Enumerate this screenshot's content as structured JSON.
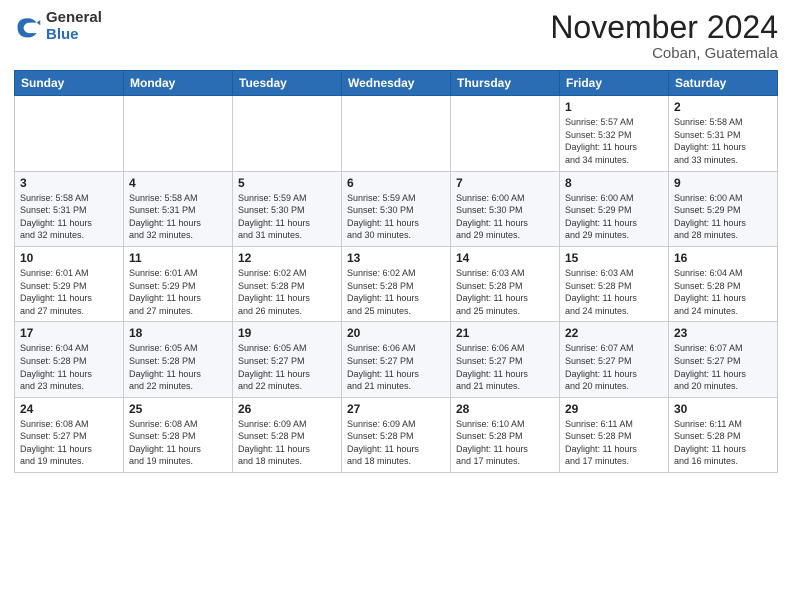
{
  "logo": {
    "general": "General",
    "blue": "Blue"
  },
  "header": {
    "month": "November 2024",
    "location": "Coban, Guatemala"
  },
  "weekdays": [
    "Sunday",
    "Monday",
    "Tuesday",
    "Wednesday",
    "Thursday",
    "Friday",
    "Saturday"
  ],
  "weeks": [
    [
      {
        "day": "",
        "info": ""
      },
      {
        "day": "",
        "info": ""
      },
      {
        "day": "",
        "info": ""
      },
      {
        "day": "",
        "info": ""
      },
      {
        "day": "",
        "info": ""
      },
      {
        "day": "1",
        "info": "Sunrise: 5:57 AM\nSunset: 5:32 PM\nDaylight: 11 hours\nand 34 minutes."
      },
      {
        "day": "2",
        "info": "Sunrise: 5:58 AM\nSunset: 5:31 PM\nDaylight: 11 hours\nand 33 minutes."
      }
    ],
    [
      {
        "day": "3",
        "info": "Sunrise: 5:58 AM\nSunset: 5:31 PM\nDaylight: 11 hours\nand 32 minutes."
      },
      {
        "day": "4",
        "info": "Sunrise: 5:58 AM\nSunset: 5:31 PM\nDaylight: 11 hours\nand 32 minutes."
      },
      {
        "day": "5",
        "info": "Sunrise: 5:59 AM\nSunset: 5:30 PM\nDaylight: 11 hours\nand 31 minutes."
      },
      {
        "day": "6",
        "info": "Sunrise: 5:59 AM\nSunset: 5:30 PM\nDaylight: 11 hours\nand 30 minutes."
      },
      {
        "day": "7",
        "info": "Sunrise: 6:00 AM\nSunset: 5:30 PM\nDaylight: 11 hours\nand 29 minutes."
      },
      {
        "day": "8",
        "info": "Sunrise: 6:00 AM\nSunset: 5:29 PM\nDaylight: 11 hours\nand 29 minutes."
      },
      {
        "day": "9",
        "info": "Sunrise: 6:00 AM\nSunset: 5:29 PM\nDaylight: 11 hours\nand 28 minutes."
      }
    ],
    [
      {
        "day": "10",
        "info": "Sunrise: 6:01 AM\nSunset: 5:29 PM\nDaylight: 11 hours\nand 27 minutes."
      },
      {
        "day": "11",
        "info": "Sunrise: 6:01 AM\nSunset: 5:29 PM\nDaylight: 11 hours\nand 27 minutes."
      },
      {
        "day": "12",
        "info": "Sunrise: 6:02 AM\nSunset: 5:28 PM\nDaylight: 11 hours\nand 26 minutes."
      },
      {
        "day": "13",
        "info": "Sunrise: 6:02 AM\nSunset: 5:28 PM\nDaylight: 11 hours\nand 25 minutes."
      },
      {
        "day": "14",
        "info": "Sunrise: 6:03 AM\nSunset: 5:28 PM\nDaylight: 11 hours\nand 25 minutes."
      },
      {
        "day": "15",
        "info": "Sunrise: 6:03 AM\nSunset: 5:28 PM\nDaylight: 11 hours\nand 24 minutes."
      },
      {
        "day": "16",
        "info": "Sunrise: 6:04 AM\nSunset: 5:28 PM\nDaylight: 11 hours\nand 24 minutes."
      }
    ],
    [
      {
        "day": "17",
        "info": "Sunrise: 6:04 AM\nSunset: 5:28 PM\nDaylight: 11 hours\nand 23 minutes."
      },
      {
        "day": "18",
        "info": "Sunrise: 6:05 AM\nSunset: 5:28 PM\nDaylight: 11 hours\nand 22 minutes."
      },
      {
        "day": "19",
        "info": "Sunrise: 6:05 AM\nSunset: 5:27 PM\nDaylight: 11 hours\nand 22 minutes."
      },
      {
        "day": "20",
        "info": "Sunrise: 6:06 AM\nSunset: 5:27 PM\nDaylight: 11 hours\nand 21 minutes."
      },
      {
        "day": "21",
        "info": "Sunrise: 6:06 AM\nSunset: 5:27 PM\nDaylight: 11 hours\nand 21 minutes."
      },
      {
        "day": "22",
        "info": "Sunrise: 6:07 AM\nSunset: 5:27 PM\nDaylight: 11 hours\nand 20 minutes."
      },
      {
        "day": "23",
        "info": "Sunrise: 6:07 AM\nSunset: 5:27 PM\nDaylight: 11 hours\nand 20 minutes."
      }
    ],
    [
      {
        "day": "24",
        "info": "Sunrise: 6:08 AM\nSunset: 5:27 PM\nDaylight: 11 hours\nand 19 minutes."
      },
      {
        "day": "25",
        "info": "Sunrise: 6:08 AM\nSunset: 5:28 PM\nDaylight: 11 hours\nand 19 minutes."
      },
      {
        "day": "26",
        "info": "Sunrise: 6:09 AM\nSunset: 5:28 PM\nDaylight: 11 hours\nand 18 minutes."
      },
      {
        "day": "27",
        "info": "Sunrise: 6:09 AM\nSunset: 5:28 PM\nDaylight: 11 hours\nand 18 minutes."
      },
      {
        "day": "28",
        "info": "Sunrise: 6:10 AM\nSunset: 5:28 PM\nDaylight: 11 hours\nand 17 minutes."
      },
      {
        "day": "29",
        "info": "Sunrise: 6:11 AM\nSunset: 5:28 PM\nDaylight: 11 hours\nand 17 minutes."
      },
      {
        "day": "30",
        "info": "Sunrise: 6:11 AM\nSunset: 5:28 PM\nDaylight: 11 hours\nand 16 minutes."
      }
    ]
  ]
}
